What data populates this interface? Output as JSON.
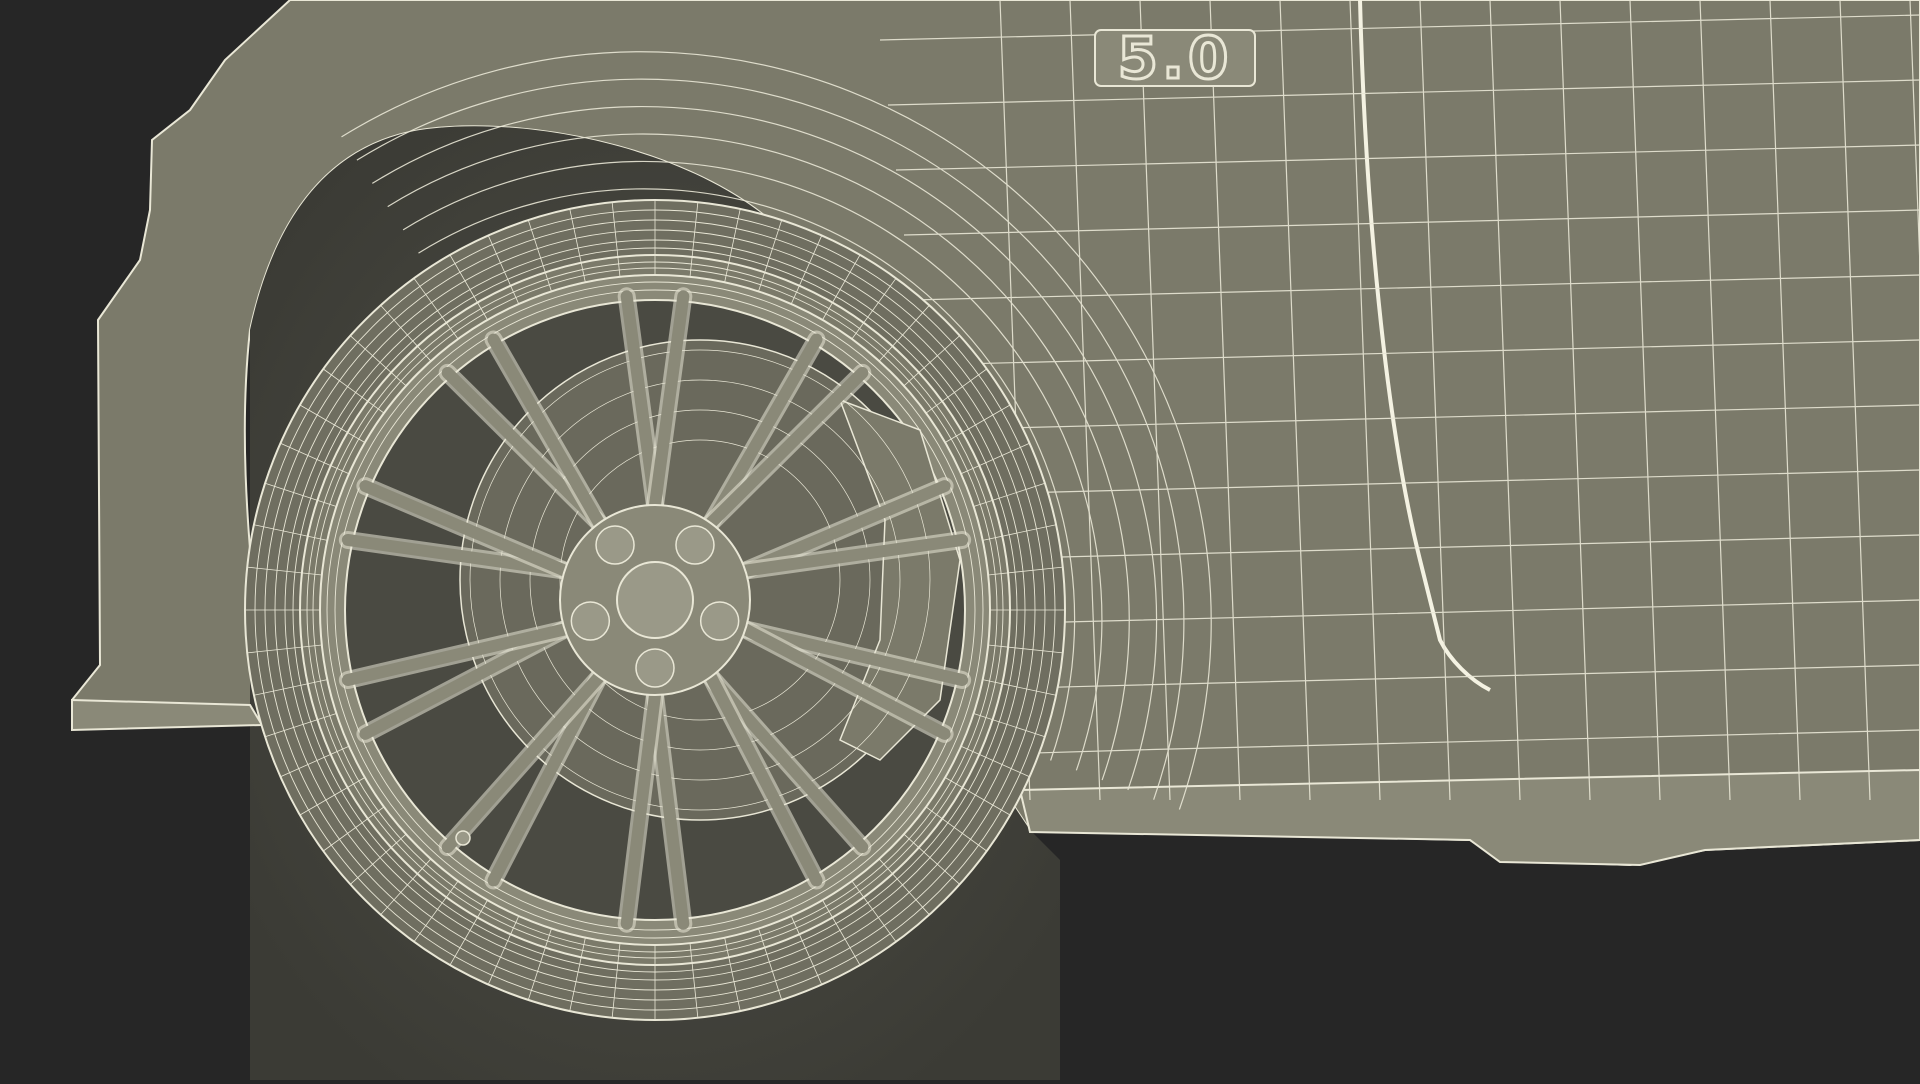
{
  "scene": {
    "badge": {
      "text": "5.0",
      "icon": "badge-emblem"
    },
    "colors": {
      "background": "#262626",
      "body": "#7b7a6a",
      "body_shadow": "#5e5d51",
      "wire": "#e9e7d6",
      "wire_dim": "#c9c7b6"
    }
  }
}
